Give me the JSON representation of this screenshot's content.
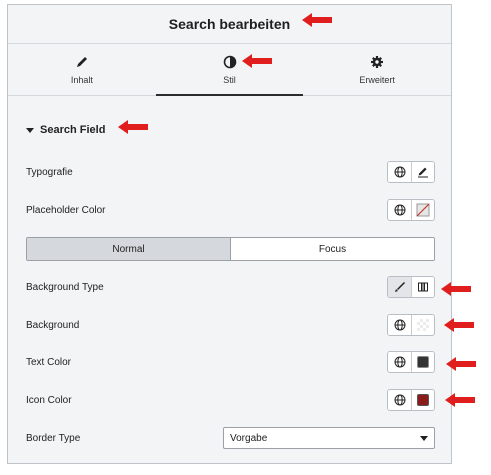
{
  "header": {
    "title": "Search bearbeiten"
  },
  "tabs": [
    {
      "label": "Inhalt",
      "icon": "pencil-icon"
    },
    {
      "label": "Stil",
      "icon": "contrast-icon"
    },
    {
      "label": "Erweitert",
      "icon": "gear-icon"
    }
  ],
  "section": {
    "title": "Search Field"
  },
  "controls": {
    "typography": "Typografie",
    "placeholder_color": "Placeholder Color",
    "background_type": "Background Type",
    "background": "Background",
    "text_color": "Text Color",
    "icon_color": "Icon Color",
    "border_type": "Border Type"
  },
  "state_tabs": {
    "normal": "Normal",
    "focus": "Focus"
  },
  "border_type_select": {
    "value": "Vorgabe"
  },
  "colors": {
    "accent_arrow": "#e01e1e",
    "text_color_swatch": "#333333",
    "icon_color_swatch": "#8b1c1c"
  }
}
